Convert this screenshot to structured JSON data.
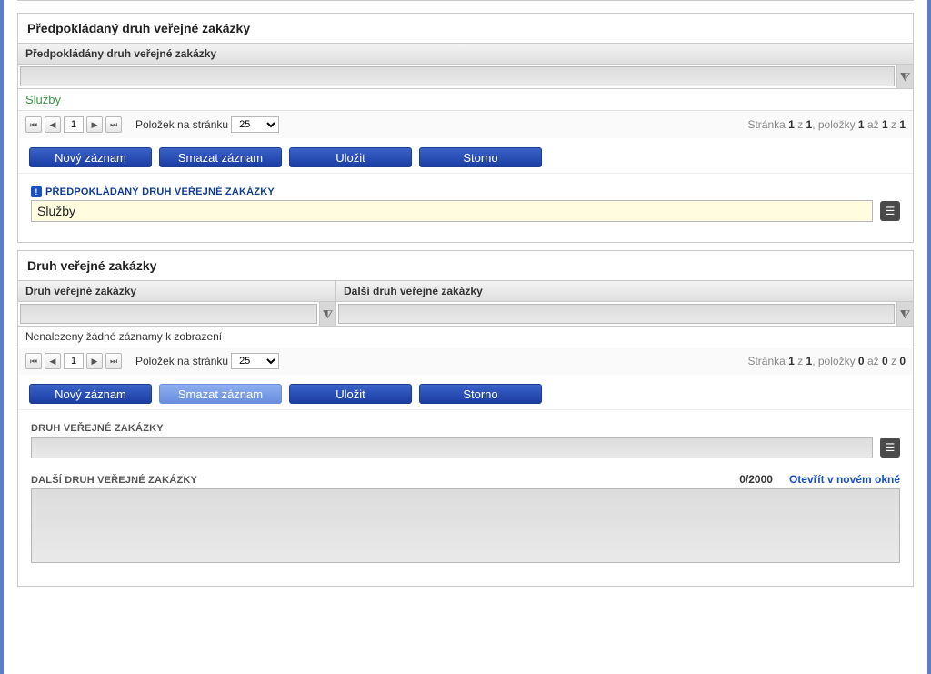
{
  "panel1": {
    "title": "Předpokládaný druh veřejné zakázky",
    "grid": {
      "columns": [
        "Předpokládány druh veřejné zakázky"
      ],
      "row_value": "Služby"
    },
    "pager": {
      "page": "1",
      "page_size": "25",
      "items_label": "Položek na stránku",
      "info_tpl": [
        "Stránka ",
        "1",
        " z ",
        "1",
        ", položky ",
        "1",
        " až ",
        "1",
        " z ",
        "1"
      ]
    },
    "buttons": {
      "new": "Nový záznam",
      "delete": "Smazat záznam",
      "save": "Uložit",
      "cancel": "Storno"
    },
    "form": {
      "label": "PŘEDPOKLÁDANÝ DRUH VEŘEJNÉ ZAKÁZKY",
      "value": "Služby"
    }
  },
  "panel2": {
    "title": "Druh veřejné zakázky",
    "grid": {
      "columns": [
        "Druh veřejné zakázky",
        "Další druh veřejné zakázky"
      ],
      "empty": "Nenalezeny žádné záznamy k zobrazení"
    },
    "pager": {
      "page": "1",
      "page_size": "25",
      "items_label": "Položek na stránku",
      "info_tpl": [
        "Stránka ",
        "1",
        " z ",
        "1",
        ", položky ",
        "0",
        " až ",
        "0",
        " z ",
        "0"
      ]
    },
    "buttons": {
      "new": "Nový záznam",
      "delete": "Smazat záznam",
      "save": "Uložit",
      "cancel": "Storno"
    },
    "form": {
      "label1": "DRUH VEŘEJNÉ ZAKÁZKY",
      "value1": "",
      "label2": "DALŠÍ DRUH VEŘEJNÉ ZAKÁZKY",
      "counter": "0/2000",
      "open_link": "Otevřít v novém okně",
      "value2": ""
    }
  }
}
